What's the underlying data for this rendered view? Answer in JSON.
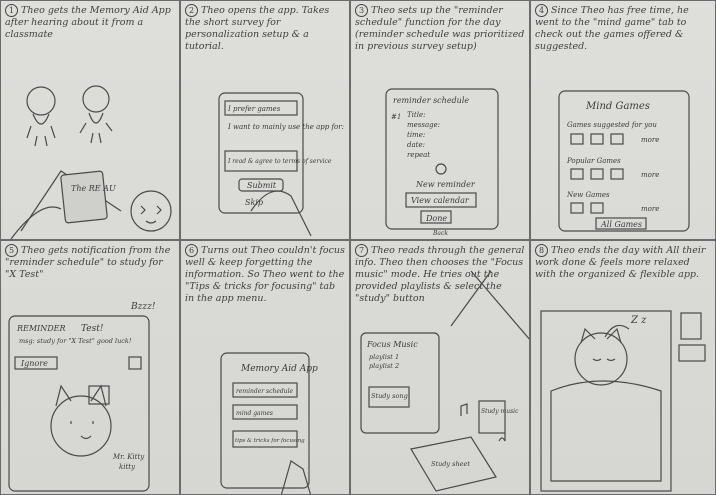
{
  "panels": [
    {
      "num": "1",
      "caption": "Theo gets the Memory Aid App after hearing about it from a classmate"
    },
    {
      "num": "2",
      "caption": "Theo opens the app. Takes the short survey for personalization setup & a tutorial."
    },
    {
      "num": "3",
      "caption": "Theo sets up the \"reminder schedule\" function for the day (reminder schedule was prioritized in previous survey setup)"
    },
    {
      "num": "4",
      "caption": "Since Theo has free time, he went to the \"mind game\" tab to check out the games offered & suggested."
    },
    {
      "num": "5",
      "caption": "Theo gets notification from the \"reminder schedule\" to study for \"X Test\""
    },
    {
      "num": "6",
      "caption": "Turns out Theo couldn't focus well & keep forgetting the information. So Theo went to the \"Tips & tricks for focusing\" tab in the app menu."
    },
    {
      "num": "7",
      "caption": "Theo reads through the general info. Theo then chooses the \"Focus music\" mode. He tries out the provided playlists & select the \"study\" button"
    },
    {
      "num": "8",
      "caption": "Theo ends the day with All their work done & feels more relaxed with the organized & flexible app."
    }
  ],
  "p1": {
    "phone_text": "The RE AU"
  },
  "p2": {
    "lines": [
      "I prefer games",
      "I want to mainly use the app for:",
      "I read & agree to terms of service"
    ],
    "submit": "Submit",
    "skip": "Skip"
  },
  "p3": {
    "header": "reminder schedule",
    "item": "#1",
    "title": "Title:",
    "message": "message:",
    "time": "time:",
    "date": "date:",
    "repeat": "repeat",
    "new_reminder": "New reminder",
    "view_calendar": "View calendar",
    "done": "Done",
    "back": "Back"
  },
  "p4": {
    "header": "Mind Games",
    "suggested": "Games suggested for you",
    "popular": "Popular Games",
    "new": "New Games",
    "more": "more",
    "all": "All Games"
  },
  "p5": {
    "title": "REMINDER",
    "test": "Test!",
    "body": "msg: study for \"X Test\" good luck!",
    "btn": "Ignore",
    "bzz": "Bzzz!",
    "hat": "Mr. Kitty",
    "hat2": "kitty"
  },
  "p6": {
    "app_title": "Memory Aid App",
    "items": [
      "reminder schedule",
      "mind games",
      "tips & tricks for focusing"
    ]
  },
  "p7": {
    "header": "Focus Music",
    "lists": [
      "playlist 1",
      "playlist 2"
    ],
    "study": "Study song",
    "note": "Study music",
    "paper": "Study sheet"
  },
  "p8": {
    "sound": "Z z"
  }
}
